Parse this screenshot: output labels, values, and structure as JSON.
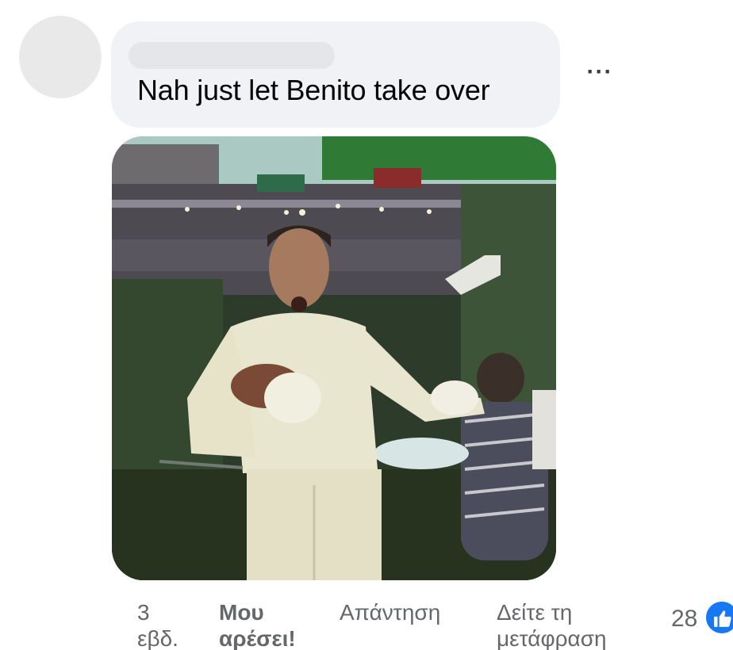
{
  "comment": {
    "text": "Nah just let Benito take over"
  },
  "actions": {
    "time_line1": "3",
    "time_line2": "εβδ.",
    "like_line1": "Μου",
    "like_line2": "αρέσει!",
    "reply": "Απάντηση",
    "translate_line1": "Δείτε τη",
    "translate_line2": "μετάφραση"
  },
  "reactions": {
    "count": "28",
    "icon": "thumbs-up-icon"
  },
  "more_icon": "ellipsis-icon",
  "colors": {
    "bubble": "#f0f2f5",
    "accent": "#1877f2",
    "secondary_text": "#65676b"
  }
}
